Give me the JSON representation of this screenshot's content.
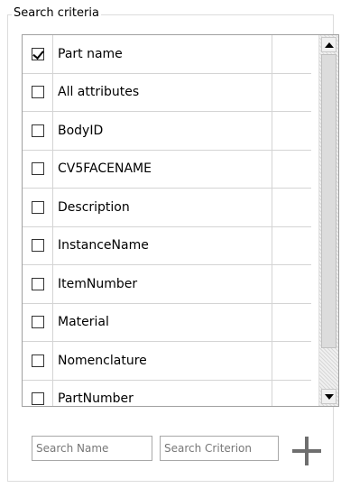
{
  "group": {
    "title": "Search criteria"
  },
  "criteria": [
    {
      "label": "Part name",
      "checked": true
    },
    {
      "label": "All attributes",
      "checked": false
    },
    {
      "label": "BodyID",
      "checked": false
    },
    {
      "label": "CV5FACENAME",
      "checked": false
    },
    {
      "label": "Description",
      "checked": false
    },
    {
      "label": "InstanceName",
      "checked": false
    },
    {
      "label": "ItemNumber",
      "checked": false
    },
    {
      "label": "Material",
      "checked": false
    },
    {
      "label": "Nomenclature",
      "checked": false
    },
    {
      "label": "PartNumber",
      "checked": false
    }
  ],
  "inputs": {
    "search_name_placeholder": "Search Name",
    "search_criterion_placeholder": "Search Criterion"
  },
  "icons": {
    "add": "plus-icon",
    "scroll_up": "arrow-up-icon",
    "scroll_down": "arrow-down-icon"
  }
}
